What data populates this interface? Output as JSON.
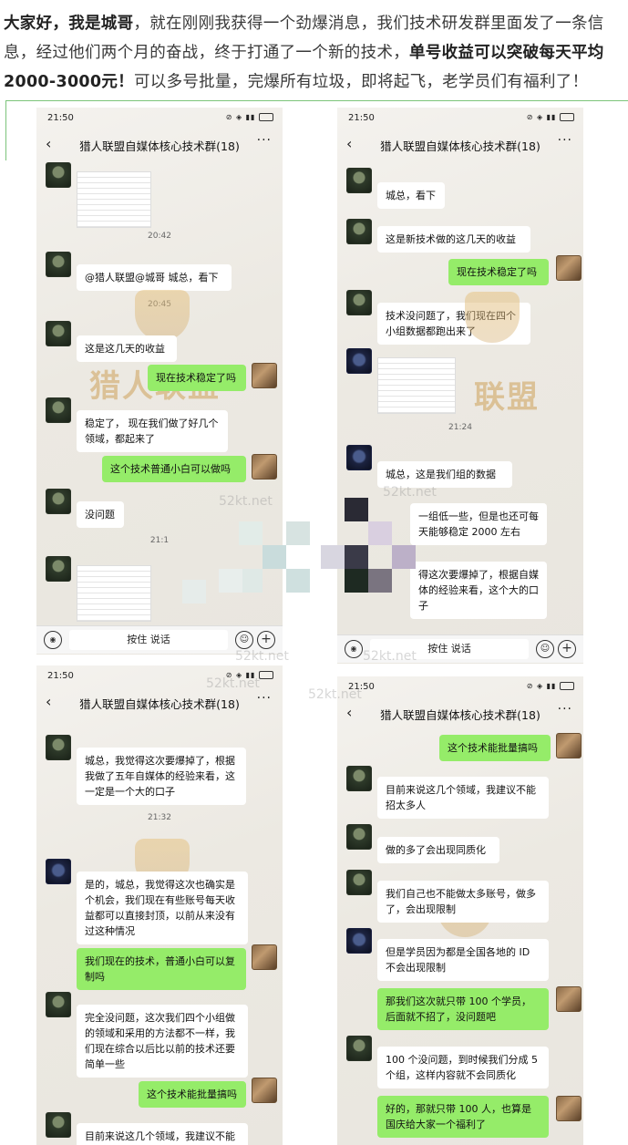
{
  "intro": {
    "p1": "大家好，我是城哥",
    "p2": "，就在刚刚我获得一个劲爆消息，我们技术研发群里面发了一条信息，经过他们两个月的奋战，终于打通了一个新的技术，",
    "p3": "单号收益可以突破每天平均2000-3000元！",
    "p4": "可以多号批量，完爆所有垃圾，即将起飞，老学员们有福利了！"
  },
  "status_time": "21:50",
  "group_title": "猎人联盟自媒体核心技术群(18)",
  "input_hold": "按住 说话",
  "watermark": "52kt.net",
  "logo_text_left": "猎人联盟",
  "logo_text_right": "联盟",
  "phone1": {
    "ts1": "20:42",
    "msg1": "@猎人联盟@城哥  城总，看下",
    "ts2": "20:45",
    "msg2": "这是这几天的收益",
    "msg3": "现在技术稳定了吗",
    "msg4": "稳定了， 现在我们做了好几个领域，都起来了",
    "msg5": "这个技术普通小白可以做吗",
    "msg6": "没问题",
    "ts3": "21:1"
  },
  "phone2": {
    "msg1": "城总，看下",
    "msg2": "这是新技术做的这几天的收益",
    "msg3": "现在技术稳定了吗",
    "msg4": "技术没问题了，我们现在四个小组数据都跑出来了",
    "ts1": "21:24",
    "msg5": "城总，这是我们组的数据",
    "msg6": "一组低一些，但是也还可每天能够稳定 2000 左右",
    "msg7": "得这次要爆掉了，根据自媒体的经验来看，这个大的口子"
  },
  "phone3": {
    "msg1": "城总，我觉得这次要爆掉了，根据我做了五年自媒体的经验来看，这一定是一个大的口子",
    "ts1": "21:32",
    "msg2": "是的，城总，我觉得这次也确实是个机会，我们现在有些账号每天收益都可以直接封顶，以前从来没有过这种情况",
    "msg3": "我们现在的技术，普通小白可以复制吗",
    "msg4": "完全没问题，这次我们四个小组做的领域和采用的方法都不一样，我们现在综合以后比以前的技术还要简单一些",
    "msg5": "这个技术能批量搞吗",
    "msg6": "目前来说这几个领域，我建议不能"
  },
  "phone4": {
    "msg1": "这个技术能批量搞吗",
    "msg2": "目前来说这几个领域，我建议不能招太多人",
    "msg3": "做的多了会出现同质化",
    "msg4": "我们自己也不能做太多账号，做多了，会出现限制",
    "msg5": "但是学员因为都是全国各地的 ID 不会出现限制",
    "msg6": "那我们这次就只带 100 个学员，后面就不招了，没问题吧",
    "msg7": "100 个没问题，到时候我们分成 5 个组，这样内容就不会同质化",
    "msg8": "好的，那就只带 100 人，也算是国庆给大家一个福利了"
  }
}
